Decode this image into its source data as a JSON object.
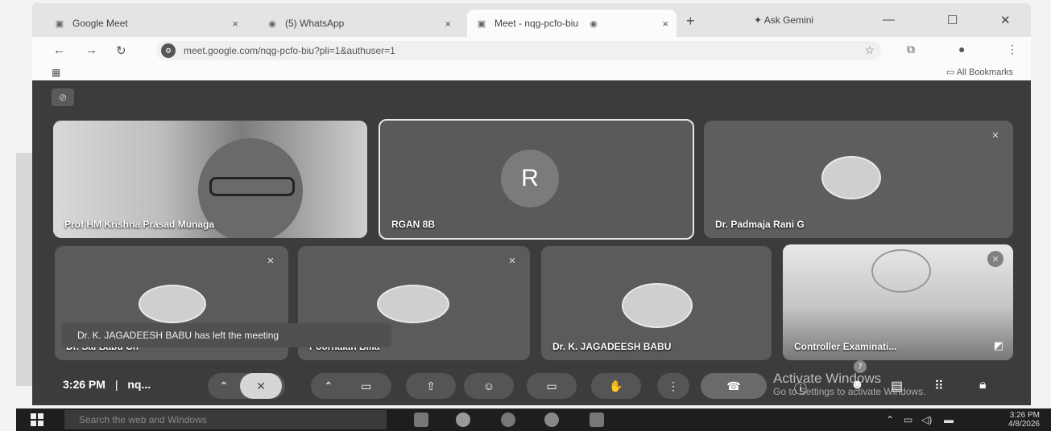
{
  "browser": {
    "tabs": [
      {
        "label": "Google Meet",
        "close": "×"
      },
      {
        "label": "(5) WhatsApp",
        "close": "×"
      },
      {
        "label": "Meet - nqg-pcfo-biu",
        "close": "×"
      }
    ],
    "new_tab": "+",
    "ask_gemini": "Ask Gemini",
    "window_controls": {
      "minimize": "—",
      "maximize": "☐",
      "close": "✕"
    },
    "url": "meet.google.com/nqg-pcfo-biu?pli=1&authuser=1",
    "bookmarks_label": "All Bookmarks"
  },
  "meet": {
    "participants": [
      {
        "name": "Prof HM Krishna Prasad Munaga"
      },
      {
        "name": "RGAN 8B",
        "initial": "R"
      },
      {
        "name": "Dr. Padmaja Rani G"
      },
      {
        "name": "Dr. Sai Babu Ch"
      },
      {
        "name": "Poornaiah Billa"
      },
      {
        "name": "Dr. K. JAGADEESH BABU"
      },
      {
        "name": "Controller Examinati..."
      }
    ],
    "notification": "Dr. K. JAGADEESH BABU has left the meeting",
    "bottom_bar": {
      "time": "3:26 PM",
      "separator": "|",
      "meeting_code": "nq...",
      "people_count": "7"
    }
  },
  "windows_watermark": {
    "line1": "Activate Windows",
    "line2": "Go to Settings to activate Windows."
  },
  "taskbar": {
    "search_placeholder": "Search the web and Windows",
    "time": "3:26 PM",
    "date": "4/8/2026"
  },
  "colors": {
    "meet_bg": "#3c3c3c",
    "tile_bg": "#5f5f5f",
    "chrome_bg": "#e4e4e4"
  }
}
